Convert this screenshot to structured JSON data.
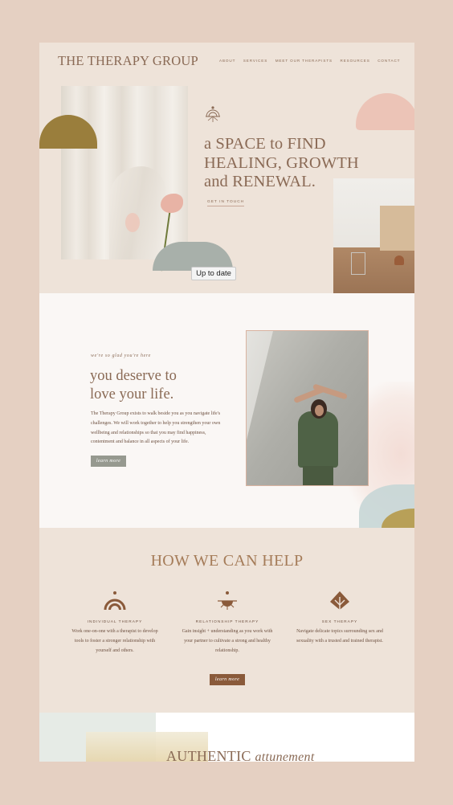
{
  "header": {
    "logo": "THE THERAPY GROUP",
    "nav": [
      "ABOUT",
      "SERVICES",
      "MEET OUR THERAPISTS",
      "RESOURCES",
      "CONTACT"
    ]
  },
  "hero": {
    "headline_lines": [
      "a SPACE to FIND",
      "HEALING, GROWTH",
      "and RENEWAL."
    ],
    "cta": "GET IN TOUCH",
    "badge": "Up to date"
  },
  "intro": {
    "eyebrow": "we're so glad you're here",
    "title_lines": [
      "you deserve to",
      "love your life."
    ],
    "body": "The Therapy Group exists to walk beside you as you navigate life's challenges. We will work together to help you strengthen your own wellbeing and relationships so that you may find happiness, contentment and balance in all aspects of your life.",
    "button": "learn more"
  },
  "help": {
    "title": "HOW WE CAN HELP",
    "services": [
      {
        "name": "INDIVIDUAL THERAPY",
        "icon": "rainbow-icon",
        "desc": "Work one-on-one with a therapist to develop tools to foster a stronger relationship with yourself and others."
      },
      {
        "name": "RELATIONSHIP THERAPY",
        "icon": "sun-icon",
        "desc": "Gain insight + understanding as you work with your partner to cultivate a strong and healthy relationship."
      },
      {
        "name": "SEX THERAPY",
        "icon": "leaf-icon",
        "desc": "Navigate delicate topics surrounding sex and sexuality with a trusted and trained therapist."
      }
    ],
    "button": "learn more"
  },
  "authentic": {
    "title_main": "AUTHENTIC",
    "title_italic": "attunement"
  },
  "colors": {
    "outer_background": "#e5d0c2",
    "hero_background": "#eee3d9",
    "text_brown": "#8a6a55",
    "button_sage": "#96998f",
    "button_brown": "#8a5a3a"
  }
}
